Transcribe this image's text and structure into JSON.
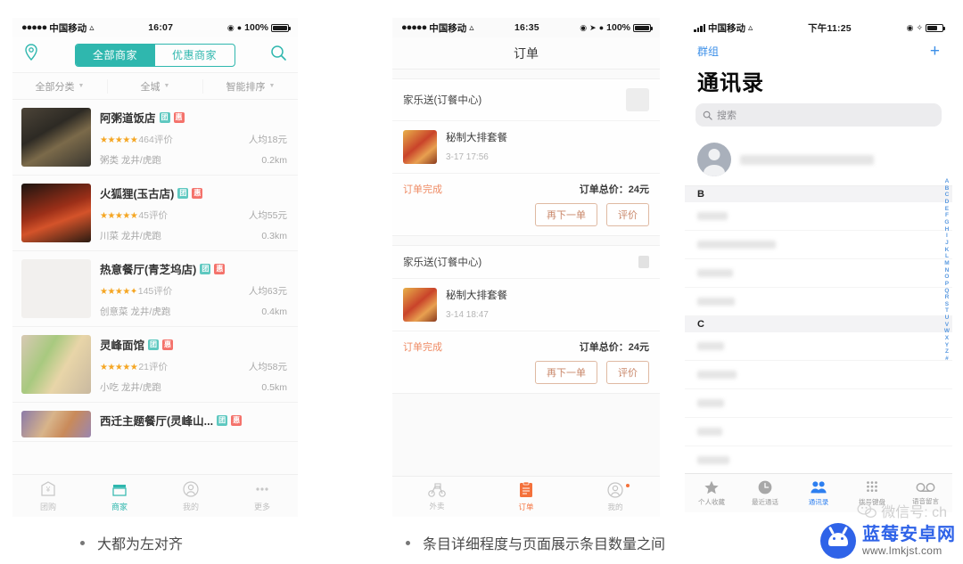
{
  "panel1": {
    "status": {
      "carrier": "中国移动",
      "time": "16:07",
      "battery": "100%"
    },
    "segments": [
      {
        "label": "全部商家",
        "active": true
      },
      {
        "label": "优惠商家",
        "active": false
      }
    ],
    "icons": {
      "location": "location-pin-icon",
      "search": "search-icon"
    },
    "filters": [
      "全部分类",
      "全城",
      "智能排序"
    ],
    "restaurants": [
      {
        "name": "阿粥道饭店",
        "stars": "★★★★★",
        "reviews": "464评价",
        "price": "人均18元",
        "category": "粥类 龙井/虎跑",
        "distance": "0.2km",
        "tags": [
          "团",
          "惠"
        ]
      },
      {
        "name": "火狐狸(玉古店)",
        "stars": "★★★★★",
        "reviews": "45评价",
        "price": "人均55元",
        "category": "川菜 龙井/虎跑",
        "distance": "0.3km",
        "tags": [
          "团",
          "惠"
        ]
      },
      {
        "name": "热意餐厅(青芝坞店)",
        "stars": "★★★★✦",
        "reviews": "145评价",
        "price": "人均63元",
        "category": "创意菜 龙井/虎跑",
        "distance": "0.4km",
        "tags": [
          "团",
          "惠"
        ]
      },
      {
        "name": "灵峰面馆",
        "stars": "★★★★★",
        "reviews": "21评价",
        "price": "人均58元",
        "category": "小吃 龙井/虎跑",
        "distance": "0.5km",
        "tags": [
          "团",
          "惠"
        ]
      },
      {
        "name": "西迁主题餐厅(灵峰山...",
        "stars": "",
        "reviews": "",
        "price": "",
        "category": "",
        "distance": "",
        "tags": [
          "团",
          "惠"
        ]
      }
    ],
    "tabs": [
      {
        "label": "团购",
        "icon": "coupon-icon",
        "active": false
      },
      {
        "label": "商家",
        "icon": "shop-icon",
        "active": true
      },
      {
        "label": "我的",
        "icon": "person-icon",
        "active": false
      },
      {
        "label": "更多",
        "icon": "more-dots-icon",
        "active": false
      }
    ]
  },
  "panel2": {
    "status": {
      "carrier": "中国移动",
      "time": "16:35",
      "battery": "100%"
    },
    "title": "订单",
    "orders": [
      {
        "shop": "家乐送(订餐中心)",
        "item": "秘制大排套餐",
        "time": "3-17 17:56",
        "status": "订单完成",
        "total": "订单总价：24元",
        "buttons": [
          "再下一单",
          "评价"
        ]
      },
      {
        "shop": "家乐送(订餐中心)",
        "item": "秘制大排套餐",
        "time": "3-14 18:47",
        "status": "订单完成",
        "total": "订单总价：24元",
        "buttons": [
          "再下一单",
          "评价"
        ]
      }
    ],
    "tabs": [
      {
        "label": "外卖",
        "icon": "scooter-icon",
        "active": false
      },
      {
        "label": "订单",
        "icon": "clipboard-icon",
        "active": true
      },
      {
        "label": "我的",
        "icon": "person-icon",
        "active": false,
        "badge": true
      }
    ]
  },
  "panel3": {
    "status": {
      "carrier": "中国移动",
      "time": "下午11:25"
    },
    "groups_label": "群组",
    "add_label": "+",
    "title": "通讯录",
    "search_placeholder": "搜索",
    "sections": [
      {
        "letter": "B",
        "rows": 4
      },
      {
        "letter": "C",
        "rows": 5
      }
    ],
    "index": [
      "A",
      "B",
      "C",
      "D",
      "E",
      "F",
      "G",
      "H",
      "I",
      "J",
      "K",
      "L",
      "M",
      "N",
      "O",
      "P",
      "Q",
      "R",
      "S",
      "T",
      "U",
      "V",
      "W",
      "X",
      "Y",
      "Z",
      "#"
    ],
    "tabs": [
      {
        "label": "个人收藏",
        "icon": "star-icon",
        "active": false
      },
      {
        "label": "最近通话",
        "icon": "clock-icon",
        "active": false
      },
      {
        "label": "通讯录",
        "icon": "contacts-icon",
        "active": true
      },
      {
        "label": "拨号键盘",
        "icon": "keypad-icon",
        "active": false
      },
      {
        "label": "语音留言",
        "icon": "voicemail-icon",
        "active": false
      }
    ]
  },
  "captions": {
    "left": "大都为左对齐",
    "right": "条目详细程度与页面展示条目数量之间"
  },
  "watermark": {
    "wechat": "微信号: ch",
    "site_name": "蓝莓安卓网",
    "site_url": "www.lmkjst.com"
  },
  "colors": {
    "teal": "#2fb7ae",
    "orange": "#f4713b",
    "blue": "#2d7ff0",
    "star": "#f5a623"
  }
}
